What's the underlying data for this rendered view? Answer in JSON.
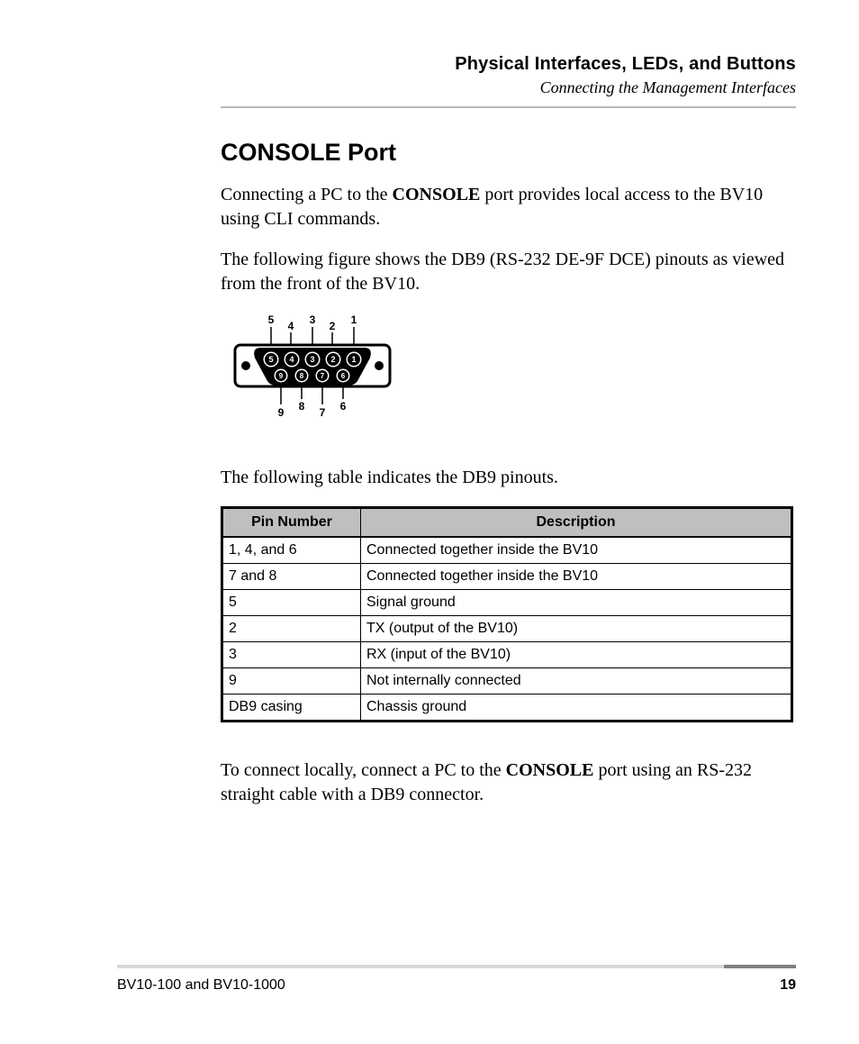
{
  "header": {
    "title": "Physical Interfaces, LEDs, and Buttons",
    "subtitle": "Connecting the Management Interfaces"
  },
  "section": {
    "heading": "CONSOLE Port",
    "para1_a": "Connecting a PC to the ",
    "para1_bold": "CONSOLE",
    "para1_b": " port provides local access to the BV10 using CLI commands.",
    "para2": "The following figure shows the DB9 (RS-232 DE-9F DCE) pinouts as viewed from the front of the BV10.",
    "para3": "The following table indicates the DB9 pinouts.",
    "para4_a": "To connect locally, connect a PC to the ",
    "para4_bold": "CONSOLE",
    "para4_b": " port using an RS-232 straight cable with a DB9 connector."
  },
  "figure": {
    "top_labels": [
      "5",
      "4",
      "3",
      "2",
      "1"
    ],
    "row1_pins": [
      "5",
      "4",
      "3",
      "2",
      "1"
    ],
    "row2_pins": [
      "9",
      "8",
      "7",
      "6"
    ],
    "bottom_labels": [
      "9",
      "8",
      "7",
      "6"
    ]
  },
  "table": {
    "headers": [
      "Pin Number",
      "Description"
    ],
    "rows": [
      [
        "1, 4, and 6",
        "Connected together inside the BV10"
      ],
      [
        "7 and 8",
        "Connected together inside the BV10"
      ],
      [
        "5",
        "Signal ground"
      ],
      [
        "2",
        "TX (output of the BV10)"
      ],
      [
        "3",
        "RX (input of the BV10)"
      ],
      [
        "9",
        "Not internally connected"
      ],
      [
        "DB9 casing",
        "Chassis ground"
      ]
    ]
  },
  "footer": {
    "left": "BV10-100 and BV10-1000",
    "page": "19"
  }
}
